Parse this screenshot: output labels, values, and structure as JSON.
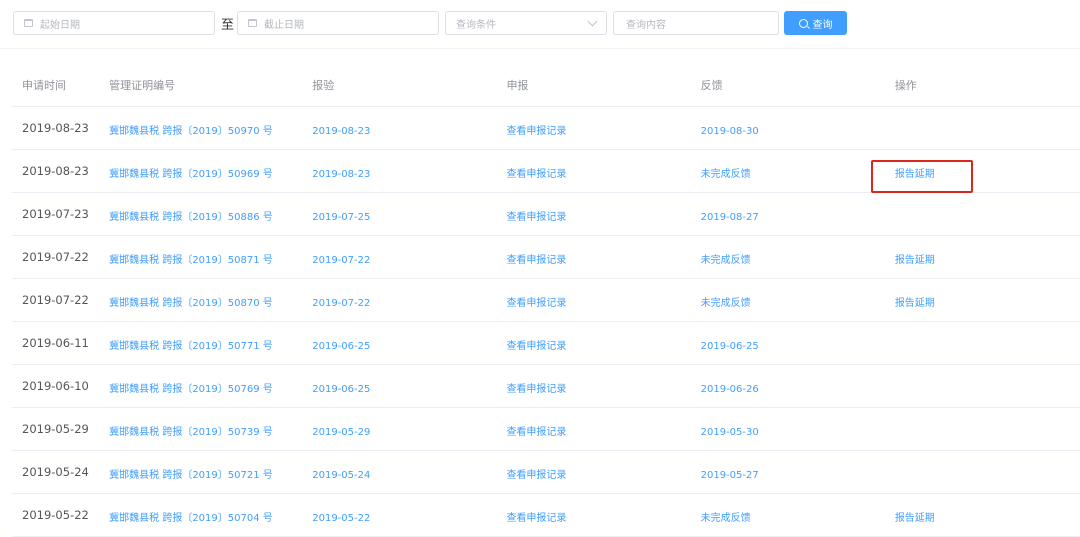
{
  "filters": {
    "start_date_placeholder": "起始日期",
    "to_label": "至",
    "end_date_placeholder": "截止日期",
    "condition_placeholder": "查询条件",
    "content_placeholder": "查询内容",
    "search_label": "查询"
  },
  "table": {
    "headers": [
      "申请时间",
      "管理证明编号",
      "报验",
      "申报",
      "反馈",
      "操作"
    ],
    "rows": [
      {
        "apply_time": "2019-08-23",
        "cert_no": "冀邯魏县税 跨报〔2019〕50970 号",
        "inspect": "2019-08-23",
        "declare": "查看申报记录",
        "feedback": "2019-08-30",
        "action": ""
      },
      {
        "apply_time": "2019-08-23",
        "cert_no": "冀邯魏县税 跨报〔2019〕50969 号",
        "inspect": "2019-08-23",
        "declare": "查看申报记录",
        "feedback": "未完成反馈",
        "action": "报告延期"
      },
      {
        "apply_time": "2019-07-23",
        "cert_no": "冀邯魏县税 跨报〔2019〕50886 号",
        "inspect": "2019-07-25",
        "declare": "查看申报记录",
        "feedback": "2019-08-27",
        "action": ""
      },
      {
        "apply_time": "2019-07-22",
        "cert_no": "冀邯魏县税 跨报〔2019〕50871 号",
        "inspect": "2019-07-22",
        "declare": "查看申报记录",
        "feedback": "未完成反馈",
        "action": "报告延期"
      },
      {
        "apply_time": "2019-07-22",
        "cert_no": "冀邯魏县税 跨报〔2019〕50870 号",
        "inspect": "2019-07-22",
        "declare": "查看申报记录",
        "feedback": "未完成反馈",
        "action": "报告延期"
      },
      {
        "apply_time": "2019-06-11",
        "cert_no": "冀邯魏县税 跨报〔2019〕50771 号",
        "inspect": "2019-06-25",
        "declare": "查看申报记录",
        "feedback": "2019-06-25",
        "action": ""
      },
      {
        "apply_time": "2019-06-10",
        "cert_no": "冀邯魏县税 跨报〔2019〕50769 号",
        "inspect": "2019-06-25",
        "declare": "查看申报记录",
        "feedback": "2019-06-26",
        "action": ""
      },
      {
        "apply_time": "2019-05-29",
        "cert_no": "冀邯魏县税 跨报〔2019〕50739 号",
        "inspect": "2019-05-29",
        "declare": "查看申报记录",
        "feedback": "2019-05-30",
        "action": ""
      },
      {
        "apply_time": "2019-05-24",
        "cert_no": "冀邯魏县税 跨报〔2019〕50721 号",
        "inspect": "2019-05-24",
        "declare": "查看申报记录",
        "feedback": "2019-05-27",
        "action": ""
      },
      {
        "apply_time": "2019-05-22",
        "cert_no": "冀邯魏县税 跨报〔2019〕50704 号",
        "inspect": "2019-05-22",
        "declare": "查看申报记录",
        "feedback": "未完成反馈",
        "action": "报告延期"
      }
    ]
  },
  "colors": {
    "link": "#409eff",
    "primary_button": "#409eff",
    "highlight": "#d9271e"
  },
  "highlighted_row": 1
}
